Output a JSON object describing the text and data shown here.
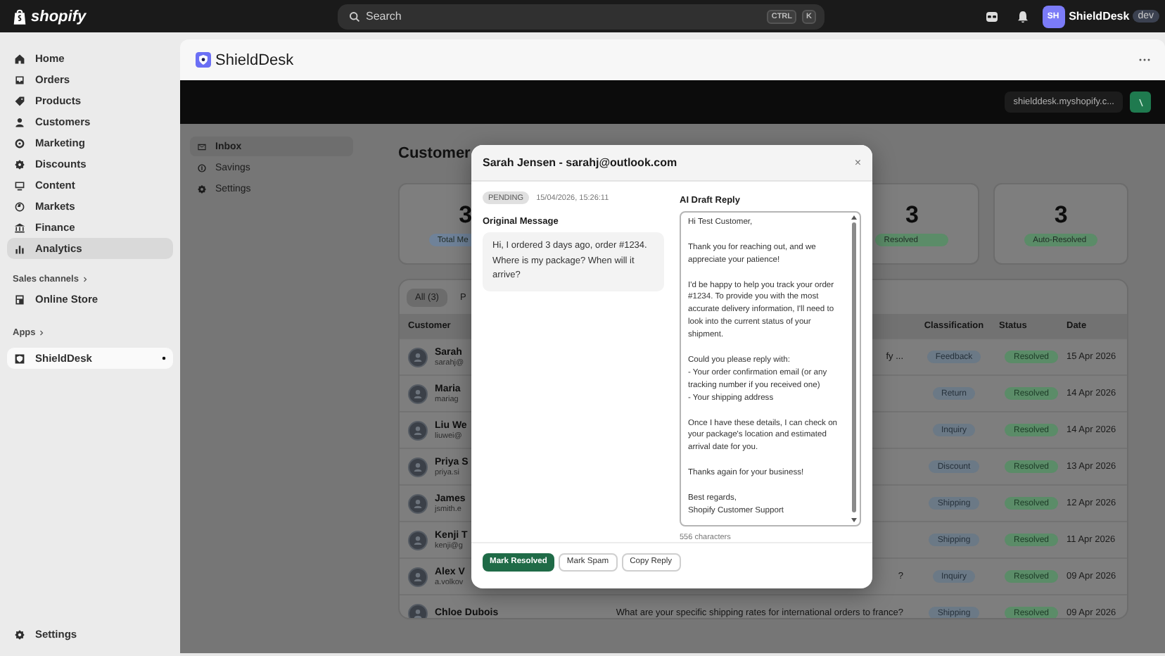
{
  "topbar": {
    "logo": "shopify",
    "search": {
      "placeholder": "Search",
      "keys": [
        "CTRL",
        "K"
      ]
    },
    "avatar": "SH",
    "store": "ShieldDesk",
    "badge": "dev"
  },
  "sidebar": {
    "items": [
      {
        "label": "Home",
        "selected": false,
        "hovered": false
      },
      {
        "label": "Orders",
        "selected": false,
        "hovered": false
      },
      {
        "label": "Products",
        "selected": false,
        "hovered": false
      },
      {
        "label": "Customers",
        "selected": false,
        "hovered": false
      },
      {
        "label": "Marketing",
        "selected": false,
        "hovered": false
      },
      {
        "label": "Discounts",
        "selected": false,
        "hovered": false
      },
      {
        "label": "Content",
        "selected": false,
        "hovered": false
      },
      {
        "label": "Markets",
        "selected": false,
        "hovered": false
      },
      {
        "label": "Finance",
        "selected": false,
        "hovered": false
      },
      {
        "label": "Analytics",
        "selected": false,
        "hovered": true
      }
    ],
    "sections": [
      {
        "label": "Sales channels",
        "items": [
          {
            "label": "Online Store",
            "selected": false
          }
        ]
      },
      {
        "label": "Apps",
        "items": [
          {
            "label": "ShieldDesk",
            "selected": true
          }
        ]
      }
    ],
    "footer": "Settings"
  },
  "app": {
    "title": "ShieldDesk",
    "domain": "shielddesk.myshopify.c..."
  },
  "app_nav": [
    {
      "label": "Inbox",
      "selected": true
    },
    {
      "label": "Savings",
      "selected": false
    },
    {
      "label": "Settings",
      "selected": false
    }
  ],
  "page": {
    "heading": "Customer"
  },
  "stats": [
    {
      "value": "3",
      "label": "Total Me",
      "color": "#6f8299"
    },
    {
      "value": "3",
      "label": "Resolved",
      "color": "#5b8c68"
    },
    {
      "value": "3",
      "label": "Auto-Resolved",
      "color": "#5b8c68"
    }
  ],
  "table": {
    "tabs": [
      {
        "label": "All (3)",
        "selected": true
      },
      {
        "label": "P",
        "selected": false
      }
    ],
    "columns": [
      "Customer",
      "Classification",
      "Status",
      "Date"
    ],
    "rows": [
      {
        "name": "Sarah",
        "email": "sarahj@",
        "message": "fy ...",
        "classification": "Feedback",
        "status": "Resolved",
        "date": "15 Apr 2026"
      },
      {
        "name": "Maria",
        "email": "mariag",
        "classification": "Return",
        "status": "Resolved",
        "date": "14 Apr 2026"
      },
      {
        "name": "Liu We",
        "email": "liuwei@",
        "classification": "Inquiry",
        "status": "Resolved",
        "date": "14 Apr 2026"
      },
      {
        "name": "Priya S",
        "email": "priya.si",
        "classification": "Discount",
        "status": "Resolved",
        "date": "13 Apr 2026"
      },
      {
        "name": "James",
        "email": "jsmith.e",
        "classification": "Shipping",
        "status": "Resolved",
        "date": "12 Apr 2026"
      },
      {
        "name": "Kenji T",
        "email": "kenji@g",
        "classification": "Shipping",
        "status": "Resolved",
        "date": "11 Apr 2026"
      },
      {
        "name": "Alex V",
        "email": "a.volkov",
        "message": "?",
        "classification": "Inquiry",
        "status": "Resolved",
        "date": "09 Apr 2026"
      },
      {
        "name": "Chloe Dubois",
        "message": "What are your specific shipping rates for international orders to france?",
        "classification": "Shipping",
        "status": "Resolved",
        "date": "09 Apr 2026"
      }
    ]
  },
  "modal": {
    "title": "Sarah Jensen - sarahj@outlook.com",
    "close": "×",
    "status": "PENDING",
    "timestamp": "15/04/2026, 15:26:11",
    "original_label": "Original Message",
    "original": "Hi, I ordered 3 days ago, order #1234. Where is my package? When will it arrive?",
    "reply_label": "AI Draft Reply",
    "reply": "Hi Test Customer,\n\nThank you for reaching out, and we appreciate your patience!\n\nI'd be happy to help you track your order #1234. To provide you with the most accurate delivery information, I'll need to look into the current status of your shipment.\n\nCould you please reply with:\n- Your order confirmation email (or any tracking number if you received one)\n- Your shipping address\n\nOnce I have these details, I can check on your package's location and estimated arrival date for you.\n\nThanks again for your business!\n\nBest regards,\nShopify Customer Support",
    "char_count": "556 characters",
    "buttons": [
      {
        "label": "Mark Resolved",
        "kind": "primary"
      },
      {
        "label": "Mark Spam",
        "kind": "secondary"
      },
      {
        "label": "Copy Reply",
        "kind": "secondary"
      }
    ]
  }
}
